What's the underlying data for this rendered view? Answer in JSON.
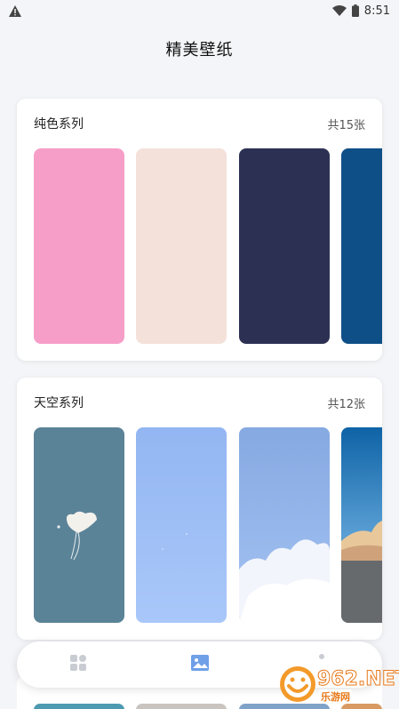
{
  "status_bar": {
    "time": "8:51",
    "icons": [
      "warning-icon",
      "wifi-icon",
      "battery-icon"
    ]
  },
  "page_title": "精美壁纸",
  "sections": [
    {
      "title": "纯色系列",
      "count": "共15张",
      "thumbnails": [
        {
          "name": "pink",
          "color": "#f79ec8"
        },
        {
          "name": "beige",
          "color": "#f3e1da"
        },
        {
          "name": "navy",
          "color": "#2c3154"
        },
        {
          "name": "blue",
          "color": "#0f4f87"
        }
      ]
    },
    {
      "title": "天空系列",
      "count": "共12张",
      "thumbnails": [
        {
          "name": "steel-blue-heart-cloud",
          "color": "#5a8499"
        },
        {
          "name": "light-blue-sky",
          "color": "#9dbdf5"
        },
        {
          "name": "blue-sky-clouds",
          "color": "#8eb0e6"
        },
        {
          "name": "deep-blue-sunset-clouds",
          "color": "#1a6fb0"
        }
      ]
    }
  ],
  "bottom_nav": {
    "items": [
      {
        "icon": "grid-icon",
        "active": false
      },
      {
        "icon": "image-icon",
        "active": true
      },
      {
        "icon": "user-icon",
        "active": false
      }
    ]
  },
  "watermark": {
    "main": "962.NET",
    "sub": "乐游网"
  }
}
